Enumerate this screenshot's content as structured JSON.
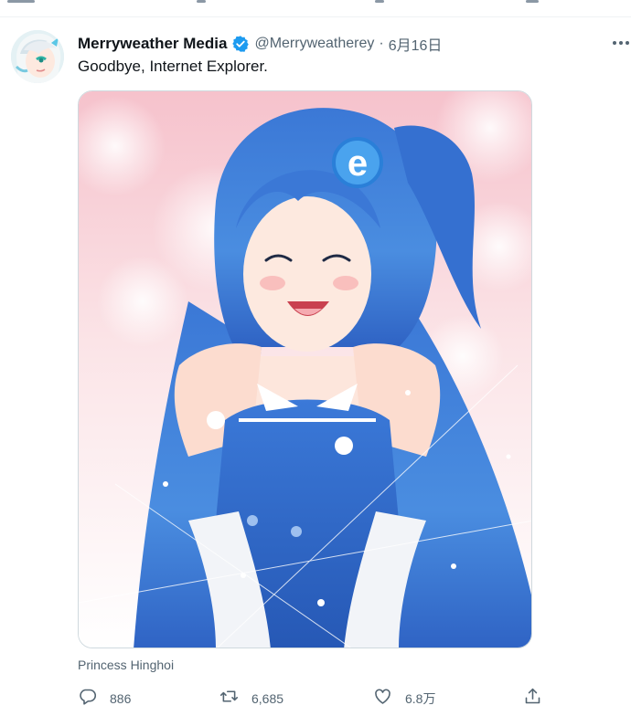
{
  "tweet": {
    "display_name": "Merryweather Media",
    "verified": true,
    "handle": "@Merryweatherey",
    "separator": "·",
    "date": "6月16日",
    "text": "Goodbye, Internet Explorer.",
    "media_caption": "Princess Hinghoi"
  },
  "actions": {
    "reply_count": "886",
    "retweet_count": "6,685",
    "like_count": "6.8万"
  },
  "icons": [
    "verified-badge-icon",
    "more-icon",
    "reply-icon",
    "retweet-icon",
    "like-icon",
    "share-icon"
  ],
  "colors": {
    "verified_blue": "#1d9bf0",
    "secondary_text": "#536471",
    "primary_text": "#0f1419",
    "hair_blue": "#3f7fd6",
    "outfit_blue": "#2e67c9"
  }
}
